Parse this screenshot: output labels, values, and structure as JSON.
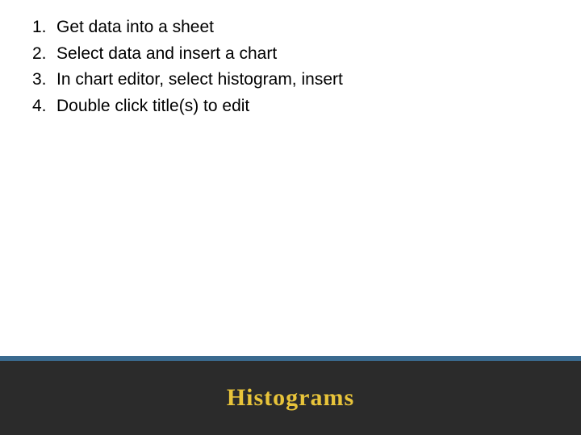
{
  "list": {
    "items": [
      {
        "number": "1.",
        "text": "Get data into a sheet"
      },
      {
        "number": "2.",
        "text": "Select data and insert a chart"
      },
      {
        "number": "3.",
        "text": "In chart editor, select histogram, insert"
      },
      {
        "number": "4.",
        "text": "Double click title(s) to edit"
      }
    ]
  },
  "footer": {
    "title": "Histograms"
  }
}
